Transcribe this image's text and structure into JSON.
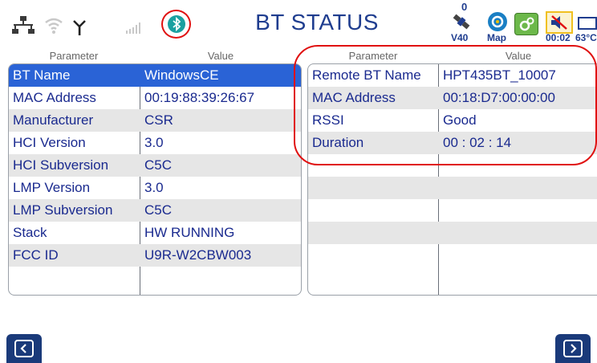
{
  "header": {
    "title": "BT STATUS",
    "satellite_count": "0",
    "satellite_label": "V40",
    "map_label": "Map",
    "time": "00:02",
    "temperature": "63°C"
  },
  "icons": [
    "network-icon",
    "wifi-icon",
    "antenna-icon",
    "signal-bars-icon",
    "bluetooth-icon",
    "satellite-icon",
    "map-icon",
    "settings-gear-icon",
    "mute-speaker-icon",
    "battery-icon"
  ],
  "left_table": {
    "param_header": "Parameter",
    "value_header": "Value",
    "rows": [
      {
        "param": "BT Name",
        "value": "WindowsCE"
      },
      {
        "param": "MAC Address",
        "value": "00:19:88:39:26:67"
      },
      {
        "param": "Manufacturer",
        "value": "CSR"
      },
      {
        "param": "HCI Version",
        "value": "3.0"
      },
      {
        "param": "HCI Subversion",
        "value": "C5C"
      },
      {
        "param": "LMP Version",
        "value": "3.0"
      },
      {
        "param": "LMP Subversion",
        "value": "C5C"
      },
      {
        "param": "Stack",
        "value": "HW RUNNING"
      },
      {
        "param": "FCC ID",
        "value": "U9R-W2CBW003"
      }
    ]
  },
  "right_table": {
    "param_header": "Parameter",
    "value_header": "Value",
    "rows": [
      {
        "param": "Remote BT Name",
        "value": "HPT435BT_10007"
      },
      {
        "param": "MAC Address",
        "value": "00:18:D7:00:00:00"
      },
      {
        "param": "RSSI",
        "value": "Good"
      },
      {
        "param": "Duration",
        "value": "00 : 02 : 14"
      }
    ]
  },
  "colors": {
    "accent": "#1f3d8f",
    "selected_row": "#2a63d6",
    "highlight": "#e01010",
    "bluetooth": "#1aa0a0"
  }
}
